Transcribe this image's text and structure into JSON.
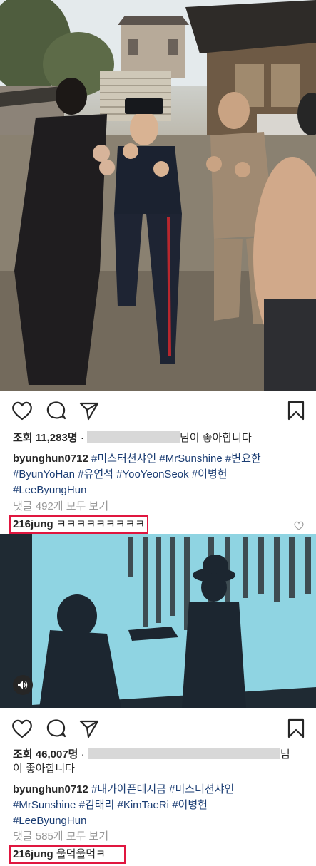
{
  "post1": {
    "views_prefix": "조회",
    "views_count": "11,283명",
    "dot": "·",
    "liked_suffix": "님이 좋아합니다",
    "username": "byunghun0712",
    "caption_lines": [
      [
        "#미스터션샤인",
        "#MrSunshine",
        "#변요한"
      ],
      [
        "#ByunYoHan",
        "#유연석",
        "#YooYeonSeok",
        "#이병헌"
      ],
      [
        "#LeeByungHun"
      ]
    ],
    "comments_link": "댓글 492개 모두 보기",
    "comment_user": "216jung",
    "comment_text": "ㅋㅋㅋㅋㅋㅋㅋㅋㅋ"
  },
  "post2": {
    "views_prefix": "조회",
    "views_count": "46,007명",
    "dot": "·",
    "liked_tail": "님",
    "liked_line2": "이 좋아합니다",
    "username": "byunghun0712",
    "caption_lines": [
      [
        "#내가아픈데지금",
        "#미스터션샤인"
      ],
      [
        "#MrSunshine",
        "#김태리",
        "#KimTaeRi",
        "#이병헌"
      ],
      [
        "#LeeByungHun"
      ]
    ],
    "comments_link": "댓글 585개 모두 보기",
    "comment_user": "216jung",
    "comment_text": "울먹울먹ㅋ"
  },
  "colors": {
    "highlight": "#e0163f",
    "hashtag": "#1b3d73",
    "muted": "#999999"
  },
  "icons": [
    "heart-icon",
    "comment-icon",
    "share-icon",
    "bookmark-icon",
    "sound-icon"
  ]
}
